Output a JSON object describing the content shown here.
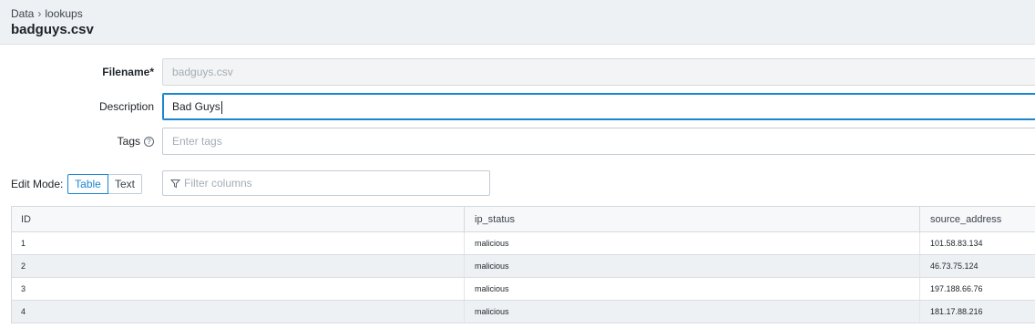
{
  "header": {
    "breadcrumb": [
      "Data",
      "lookups"
    ],
    "breadcrumb_separator": "›",
    "title": "badguys.csv"
  },
  "form": {
    "filename": {
      "label": "Filename*",
      "value": "badguys.csv"
    },
    "description": {
      "label": "Description",
      "value": "Bad Guys"
    },
    "tags": {
      "label": "Tags",
      "help_icon": "?",
      "placeholder": "Enter tags"
    }
  },
  "edit_mode": {
    "label": "Edit Mode:",
    "options": [
      "Table",
      "Text"
    ],
    "selected": "Table"
  },
  "filter": {
    "placeholder": "Filter columns",
    "icon": "funnel-icon"
  },
  "table": {
    "columns": [
      "ID",
      "ip_status",
      "source_address"
    ],
    "rows": [
      [
        "1",
        "malicious",
        "101.58.83.134"
      ],
      [
        "2",
        "malicious",
        "46.73.75.124"
      ],
      [
        "3",
        "malicious",
        "197.188.66.76"
      ],
      [
        "4",
        "malicious",
        "181.17.88.216"
      ]
    ]
  },
  "colors": {
    "accent": "#1a86d0",
    "header_bg": "#eef1f4",
    "row_alt_bg": "#eef1f4"
  }
}
